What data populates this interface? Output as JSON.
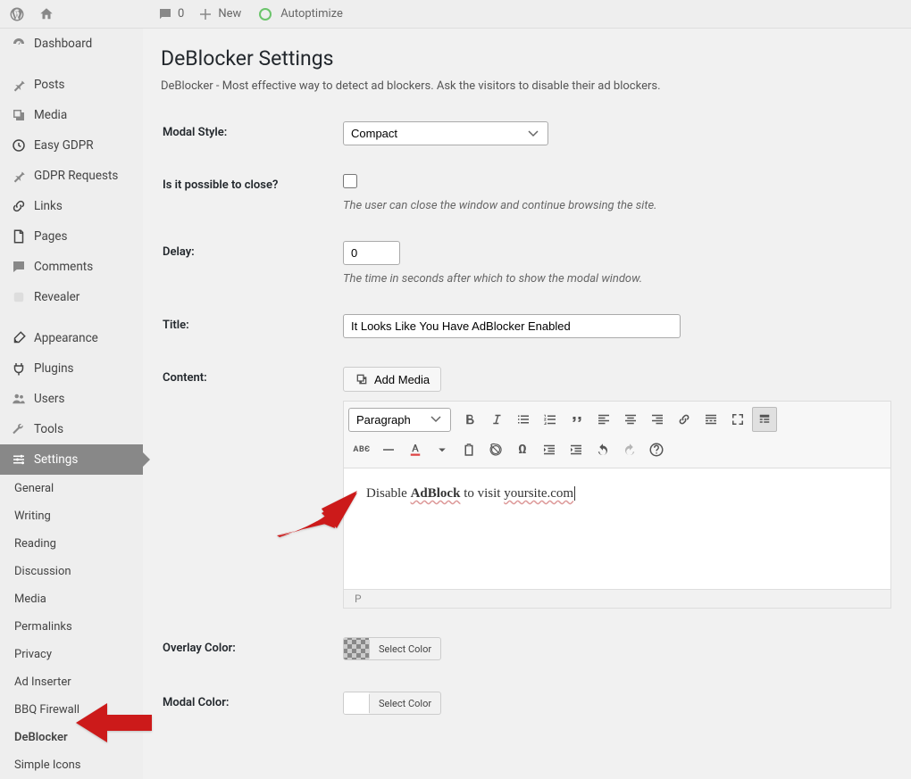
{
  "topbar": {
    "comment_count": "0",
    "new_label": "New",
    "autoptimize_label": "Autoptimize"
  },
  "sidebar": {
    "main": [
      {
        "label": "Dashboard",
        "icon": "dashboard"
      },
      {
        "label": "Posts",
        "icon": "pin"
      },
      {
        "label": "Media",
        "icon": "media"
      },
      {
        "label": "Easy GDPR",
        "icon": "clock"
      },
      {
        "label": "GDPR Requests",
        "icon": "pin"
      },
      {
        "label": "Links",
        "icon": "link"
      },
      {
        "label": "Pages",
        "icon": "page"
      },
      {
        "label": "Comments",
        "icon": "comment"
      },
      {
        "label": "Revealer",
        "icon": "blank"
      },
      {
        "label": "Appearance",
        "icon": "brush"
      },
      {
        "label": "Plugins",
        "icon": "plug"
      },
      {
        "label": "Users",
        "icon": "users"
      },
      {
        "label": "Tools",
        "icon": "wrench"
      },
      {
        "label": "Settings",
        "icon": "settings",
        "active": true
      }
    ],
    "submenu": [
      {
        "label": "General"
      },
      {
        "label": "Writing"
      },
      {
        "label": "Reading"
      },
      {
        "label": "Discussion"
      },
      {
        "label": "Media"
      },
      {
        "label": "Permalinks"
      },
      {
        "label": "Privacy"
      },
      {
        "label": "Ad Inserter"
      },
      {
        "label": "BBQ Firewall"
      },
      {
        "label": "DeBlocker",
        "current": true
      },
      {
        "label": "Simple Icons"
      }
    ]
  },
  "page": {
    "title": "DeBlocker Settings",
    "description": "DeBlocker - Most effective way to detect ad blockers. Ask the visitors to disable their ad blockers.",
    "fields": {
      "modal_style_label": "Modal Style:",
      "modal_style_value": "Compact",
      "closeable_label": "Is it possible to close?",
      "closeable_help": "The user can close the window and continue browsing the site.",
      "delay_label": "Delay:",
      "delay_value": "0",
      "delay_help": "The time in seconds after which to show the modal window.",
      "title_label": "Title:",
      "title_value": "It Looks Like You Have AdBlocker Enabled",
      "content_label": "Content:",
      "add_media_label": "Add Media",
      "paragraph_label": "Paragraph",
      "editor_text_pre": "Disable ",
      "editor_text_bold": "AdBlock",
      "editor_text_mid": " to visit ",
      "editor_text_site": "yoursite.com",
      "path_label": "P",
      "overlay_color_label": "Overlay Color:",
      "modal_color_label": "Modal Color:",
      "select_color_label": "Select Color"
    }
  }
}
